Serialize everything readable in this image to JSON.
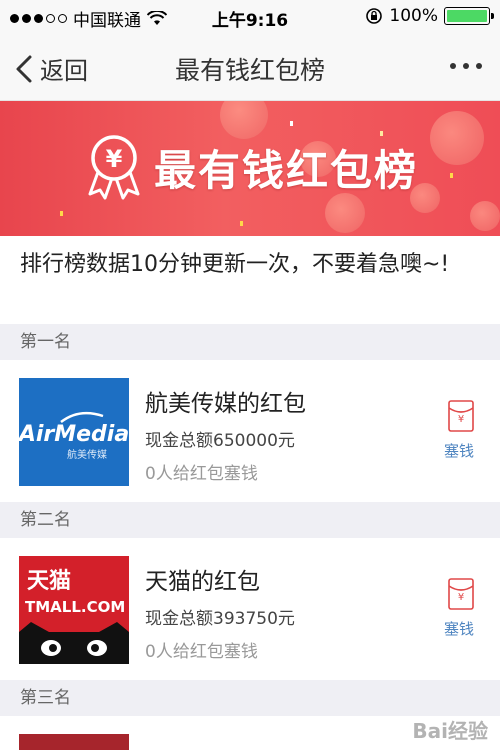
{
  "status_bar": {
    "carrier": "中国联通",
    "time": "上午9:16",
    "battery_percent": "100%"
  },
  "nav": {
    "back_label": "返回",
    "title": "最有钱红包榜"
  },
  "banner": {
    "title": "最有钱红包榜",
    "colors": {
      "accent": "#ef4d56"
    }
  },
  "notice": "排行榜数据10分钟更新一次，不要着急噢~!",
  "ranks": [
    {
      "rank_label": "第一名",
      "name": "航美传媒的红包",
      "amount": "现金总额650000元",
      "count": "0人给红包塞钱",
      "action": "塞钱",
      "logo": {
        "text": "AirMedia",
        "subtext": "航美传媒"
      }
    },
    {
      "rank_label": "第二名",
      "name": "天猫的红包",
      "amount": "现金总额393750元",
      "count": "0人给红包塞钱",
      "action": "塞钱",
      "logo": {
        "text": "天猫",
        "subtext": "TMALL.COM"
      }
    },
    {
      "rank_label": "第三名"
    }
  ],
  "watermark": "Bai经验"
}
